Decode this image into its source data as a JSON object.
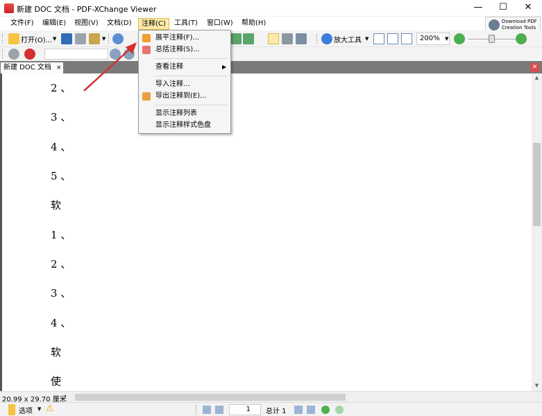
{
  "window": {
    "title": "新建 DOC 文档 - PDF-XChange Viewer"
  },
  "window_controls": {
    "minimize": "—",
    "maximize": "☐",
    "close": "✕"
  },
  "menubar": {
    "items": [
      "文件(F)",
      "编辑(E)",
      "视图(V)",
      "文档(D)",
      "注释(C)",
      "工具(T)",
      "窗口(W)",
      "帮助(H)"
    ],
    "active": "注释(C)",
    "download": [
      "Download PDF",
      "Creation Tools"
    ]
  },
  "toolbar1": {
    "open_label": "打开(O)...",
    "zoom_tool_label": "放大工具",
    "zoom_value": "200%"
  },
  "tab": {
    "label": "新建 DOC 文档",
    "close": "×"
  },
  "comments_menu": {
    "items": [
      "展平注释(F)...",
      "总括注释(S)...",
      "查看注释",
      "导入注释...",
      "导出注释到(E)...",
      "显示注释列表",
      "显示注释样式色盘"
    ]
  },
  "document": {
    "lines": [
      "2 、",
      "3 、",
      "4 、",
      "5 、",
      "软",
      "1 、",
      "2 、",
      "3 、",
      "4 、",
      "软",
      "使"
    ]
  },
  "statusbar": {
    "dimensions": "20.99 x 29.70 厘米"
  },
  "bottombar": {
    "options_label": "选项",
    "page_number": "1",
    "total_pages": "总计 1"
  },
  "colors": {
    "menu_active_bg": "#fde9a8",
    "tab_strip": "#7a7a7a",
    "annotation_arrow": "#d32f2f"
  }
}
